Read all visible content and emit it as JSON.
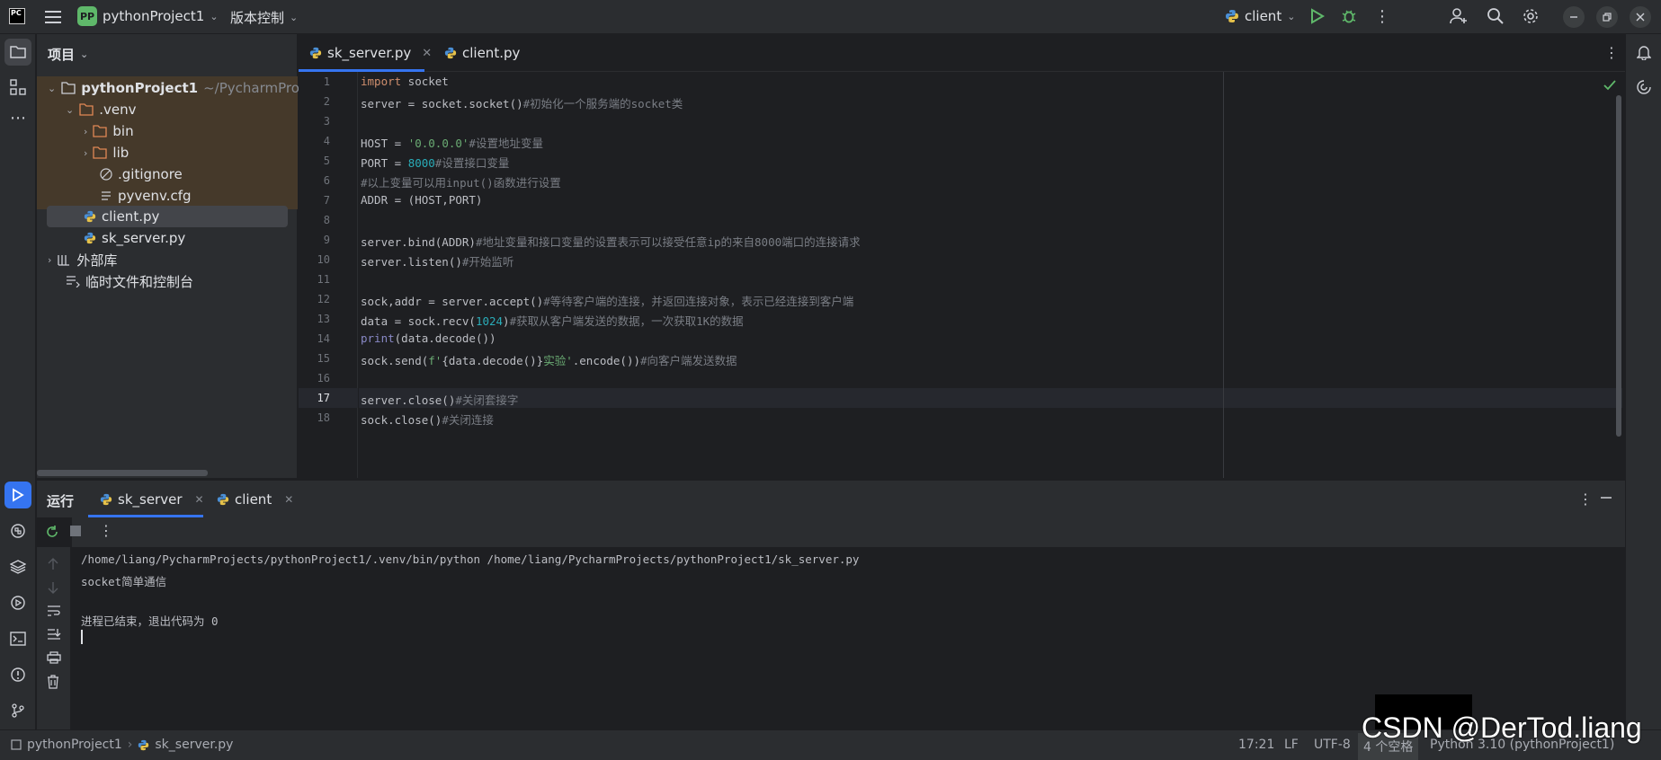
{
  "titlebar": {
    "project_badge": "PP",
    "project_name": "pythonProject1",
    "vcs_label": "版本控制",
    "run_config": "client"
  },
  "project_panel": {
    "title": "项目",
    "tree": {
      "root": "pythonProject1",
      "root_path": "~/PycharmProje",
      "venv": ".venv",
      "bin": "bin",
      "lib": "lib",
      "gitignore": ".gitignore",
      "pyvenv": "pyvenv.cfg",
      "client": "client.py",
      "sk_server": "sk_server.py",
      "external": "外部库",
      "scratch": "临时文件和控制台"
    }
  },
  "editor": {
    "tabs": [
      "sk_server.py",
      "client.py"
    ],
    "line_numbers": [
      "1",
      "2",
      "3",
      "4",
      "5",
      "6",
      "7",
      "8",
      "9",
      "10",
      "11",
      "12",
      "13",
      "14",
      "15",
      "16",
      "17",
      "18"
    ],
    "code": {
      "l1a": "import",
      "l1b": " socket",
      "l2a": "server = socket.socket()",
      "l2b": "#初始化一个服务端的socket类",
      "l4a": "HOST = ",
      "l4b": "'0.0.0.0'",
      "l4c": "#设置地址变量",
      "l5a": "PORT = ",
      "l5b": "8000",
      "l5c": "#设置接口变量",
      "l6": "#以上变量可以用input()函数进行设置",
      "l7": "ADDR = (HOST,PORT)",
      "l9a": "server.bind(ADDR)",
      "l9b": "#地址变量和接口变量的设置表示可以接受任意ip的来自8000端口的连接请求",
      "l10a": "server.listen()",
      "l10b": "#开始监听",
      "l12a": "sock,addr = server.accept()",
      "l12b": "#等待客户端的连接，并返回连接对象，表示已经连接到客户端",
      "l13a": "data = sock.recv(",
      "l13b": "1024",
      "l13c": ")",
      "l13d": "#获取从客户端发送的数据，一次获取1K的数据",
      "l14a": "print",
      "l14b": "(data.decode())",
      "l15a": "sock.send(",
      "l15b": "f'",
      "l15c": "{data.decode()}",
      "l15d": "实验'",
      "l15e": ".encode())",
      "l15f": "#向客户端发送数据",
      "l17a": "server.close()",
      "l17b": "#关闭套接字",
      "l18a": "sock.close()",
      "l18b": "#关闭连接"
    }
  },
  "run_panel": {
    "title": "运行",
    "tabs": [
      "sk_server",
      "client"
    ],
    "console": {
      "line1": "/home/liang/PycharmProjects/pythonProject1/.venv/bin/python /home/liang/PycharmProjects/pythonProject1/sk_server.py",
      "line2": "socket简单通信",
      "line3": "进程已结束，退出代码为 0"
    }
  },
  "statusbar": {
    "breadcrumb_project": "pythonProject1",
    "breadcrumb_file": "sk_server.py",
    "position": "17:21",
    "line_sep": "LF",
    "encoding": "UTF-8",
    "indent": "4 个空格",
    "interpreter": "Python 3.10 (pythonProject1)"
  },
  "watermark": "CSDN @DerTod.liang"
}
